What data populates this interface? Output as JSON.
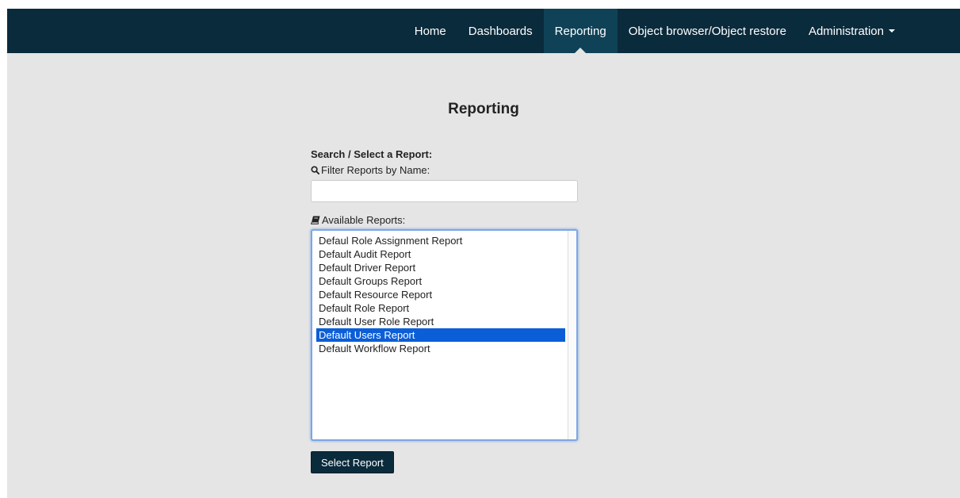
{
  "nav": {
    "items": [
      {
        "label": "Home"
      },
      {
        "label": "Dashboards"
      },
      {
        "label": "Reporting"
      },
      {
        "label": "Object browser/Object restore"
      },
      {
        "label": "Administration"
      }
    ],
    "active": "Reporting"
  },
  "page": {
    "title": "Reporting"
  },
  "search": {
    "heading": "Search / Select a Report:",
    "filter_label": "Filter Reports by Name:",
    "filter_value": "",
    "icon": "search-icon"
  },
  "reports": {
    "label": "Available Reports:",
    "icon": "book-icon",
    "items": [
      "Defaul Role Assignment Report",
      "Default Audit Report",
      "Default Driver Report",
      "Default Groups Report",
      "Default Resource Report",
      "Default Role Report",
      "Default User Role Report",
      "Default Users Report",
      "Default Workflow Report"
    ],
    "selected": "Default Users Report"
  },
  "actions": {
    "select_label": "Select Report"
  },
  "colors": {
    "navbar": "#0a2b3c",
    "nav_active": "#0f4257",
    "background": "#e5e5e5",
    "selection": "#0b5ed7",
    "focus_border": "#7ea6e4"
  }
}
